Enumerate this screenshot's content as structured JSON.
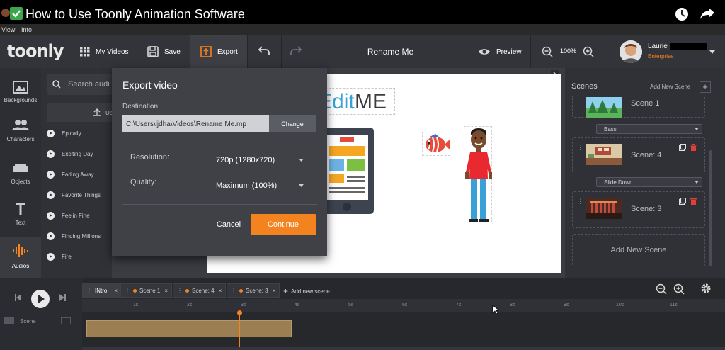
{
  "video_title": "How to Use Toonly Animation Software",
  "menu": [
    "View",
    "Info"
  ],
  "toolbar": {
    "logo": "toonly",
    "my_videos": "My Videos",
    "save": "Save",
    "export": "Export",
    "project_name": "Rename Me",
    "preview": "Preview",
    "zoom": "100%",
    "user_name": "Laurie",
    "user_plan": "Enterprise"
  },
  "sidebar": [
    {
      "label": "Backgrounds",
      "icon": "backgrounds-icon"
    },
    {
      "label": "Characters",
      "icon": "characters-icon"
    },
    {
      "label": "Objects",
      "icon": "objects-icon"
    },
    {
      "label": "Text",
      "icon": "text-icon"
    },
    {
      "label": "Audios",
      "icon": "audios-icon"
    }
  ],
  "audio_panel": {
    "search_placeholder": "Search audi",
    "upload_label": "Up",
    "items": [
      "Epically",
      "Exciting Day",
      "Fading Away",
      "Favorite Things",
      "Feelin Fine",
      "Finding Millions",
      "Fire"
    ]
  },
  "canvas": {
    "edit_text_a": "Edit",
    "edit_text_b": "ME"
  },
  "export_dialog": {
    "title": "Export video",
    "destination_label": "Destination:",
    "destination_value": "C:\\Users\\ljdha\\Videos\\Rename Me.mp",
    "change_label": "Change",
    "resolution_label": "Resolution:",
    "resolution_value": "720p (1280x720)",
    "quality_label": "Quality:",
    "quality_value": "Maximum (100%)",
    "cancel_label": "Cancel",
    "continue_label": "Continue"
  },
  "scenes": {
    "title": "Scenes",
    "add_new_link": "Add New Scene",
    "items": [
      {
        "name": "Scene 1"
      },
      {
        "name": "Scene: 4"
      },
      {
        "name": "Scene: 3"
      }
    ],
    "transitions": [
      "Bass",
      "Slide Down"
    ],
    "add_new_button": "Add New Scene"
  },
  "timeline": {
    "tabs": [
      "INtro",
      "Scene 1",
      "Scene: 4",
      "Scene: 3"
    ],
    "add_new": "Add new scene",
    "track_label": "Scene",
    "ticks": [
      "1s",
      "2s",
      "3s",
      "4s",
      "5s",
      "6s",
      "7s",
      "8s",
      "9s",
      "10s",
      "11s"
    ]
  },
  "colors": {
    "accent": "#f3831f",
    "dialog_bg": "#3f4147",
    "toolbar_bg": "#32343a"
  }
}
